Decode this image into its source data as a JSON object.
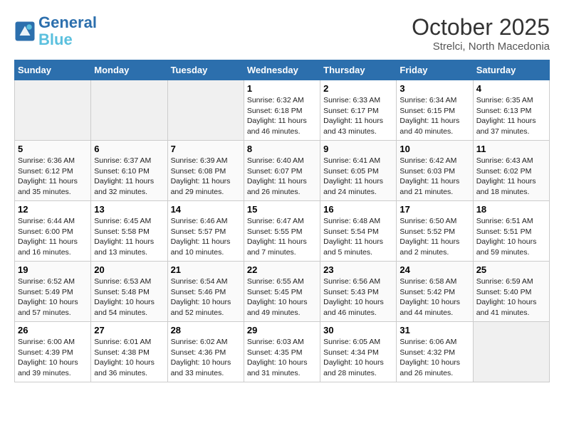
{
  "header": {
    "logo_line1": "General",
    "logo_line2": "Blue",
    "month": "October 2025",
    "location": "Strelci, North Macedonia"
  },
  "weekdays": [
    "Sunday",
    "Monday",
    "Tuesday",
    "Wednesday",
    "Thursday",
    "Friday",
    "Saturday"
  ],
  "weeks": [
    [
      {
        "day": "",
        "info": ""
      },
      {
        "day": "",
        "info": ""
      },
      {
        "day": "",
        "info": ""
      },
      {
        "day": "1",
        "info": "Sunrise: 6:32 AM\nSunset: 6:18 PM\nDaylight: 11 hours and 46 minutes."
      },
      {
        "day": "2",
        "info": "Sunrise: 6:33 AM\nSunset: 6:17 PM\nDaylight: 11 hours and 43 minutes."
      },
      {
        "day": "3",
        "info": "Sunrise: 6:34 AM\nSunset: 6:15 PM\nDaylight: 11 hours and 40 minutes."
      },
      {
        "day": "4",
        "info": "Sunrise: 6:35 AM\nSunset: 6:13 PM\nDaylight: 11 hours and 37 minutes."
      }
    ],
    [
      {
        "day": "5",
        "info": "Sunrise: 6:36 AM\nSunset: 6:12 PM\nDaylight: 11 hours and 35 minutes."
      },
      {
        "day": "6",
        "info": "Sunrise: 6:37 AM\nSunset: 6:10 PM\nDaylight: 11 hours and 32 minutes."
      },
      {
        "day": "7",
        "info": "Sunrise: 6:39 AM\nSunset: 6:08 PM\nDaylight: 11 hours and 29 minutes."
      },
      {
        "day": "8",
        "info": "Sunrise: 6:40 AM\nSunset: 6:07 PM\nDaylight: 11 hours and 26 minutes."
      },
      {
        "day": "9",
        "info": "Sunrise: 6:41 AM\nSunset: 6:05 PM\nDaylight: 11 hours and 24 minutes."
      },
      {
        "day": "10",
        "info": "Sunrise: 6:42 AM\nSunset: 6:03 PM\nDaylight: 11 hours and 21 minutes."
      },
      {
        "day": "11",
        "info": "Sunrise: 6:43 AM\nSunset: 6:02 PM\nDaylight: 11 hours and 18 minutes."
      }
    ],
    [
      {
        "day": "12",
        "info": "Sunrise: 6:44 AM\nSunset: 6:00 PM\nDaylight: 11 hours and 16 minutes."
      },
      {
        "day": "13",
        "info": "Sunrise: 6:45 AM\nSunset: 5:58 PM\nDaylight: 11 hours and 13 minutes."
      },
      {
        "day": "14",
        "info": "Sunrise: 6:46 AM\nSunset: 5:57 PM\nDaylight: 11 hours and 10 minutes."
      },
      {
        "day": "15",
        "info": "Sunrise: 6:47 AM\nSunset: 5:55 PM\nDaylight: 11 hours and 7 minutes."
      },
      {
        "day": "16",
        "info": "Sunrise: 6:48 AM\nSunset: 5:54 PM\nDaylight: 11 hours and 5 minutes."
      },
      {
        "day": "17",
        "info": "Sunrise: 6:50 AM\nSunset: 5:52 PM\nDaylight: 11 hours and 2 minutes."
      },
      {
        "day": "18",
        "info": "Sunrise: 6:51 AM\nSunset: 5:51 PM\nDaylight: 10 hours and 59 minutes."
      }
    ],
    [
      {
        "day": "19",
        "info": "Sunrise: 6:52 AM\nSunset: 5:49 PM\nDaylight: 10 hours and 57 minutes."
      },
      {
        "day": "20",
        "info": "Sunrise: 6:53 AM\nSunset: 5:48 PM\nDaylight: 10 hours and 54 minutes."
      },
      {
        "day": "21",
        "info": "Sunrise: 6:54 AM\nSunset: 5:46 PM\nDaylight: 10 hours and 52 minutes."
      },
      {
        "day": "22",
        "info": "Sunrise: 6:55 AM\nSunset: 5:45 PM\nDaylight: 10 hours and 49 minutes."
      },
      {
        "day": "23",
        "info": "Sunrise: 6:56 AM\nSunset: 5:43 PM\nDaylight: 10 hours and 46 minutes."
      },
      {
        "day": "24",
        "info": "Sunrise: 6:58 AM\nSunset: 5:42 PM\nDaylight: 10 hours and 44 minutes."
      },
      {
        "day": "25",
        "info": "Sunrise: 6:59 AM\nSunset: 5:40 PM\nDaylight: 10 hours and 41 minutes."
      }
    ],
    [
      {
        "day": "26",
        "info": "Sunrise: 6:00 AM\nSunset: 4:39 PM\nDaylight: 10 hours and 39 minutes."
      },
      {
        "day": "27",
        "info": "Sunrise: 6:01 AM\nSunset: 4:38 PM\nDaylight: 10 hours and 36 minutes."
      },
      {
        "day": "28",
        "info": "Sunrise: 6:02 AM\nSunset: 4:36 PM\nDaylight: 10 hours and 33 minutes."
      },
      {
        "day": "29",
        "info": "Sunrise: 6:03 AM\nSunset: 4:35 PM\nDaylight: 10 hours and 31 minutes."
      },
      {
        "day": "30",
        "info": "Sunrise: 6:05 AM\nSunset: 4:34 PM\nDaylight: 10 hours and 28 minutes."
      },
      {
        "day": "31",
        "info": "Sunrise: 6:06 AM\nSunset: 4:32 PM\nDaylight: 10 hours and 26 minutes."
      },
      {
        "day": "",
        "info": ""
      }
    ]
  ]
}
